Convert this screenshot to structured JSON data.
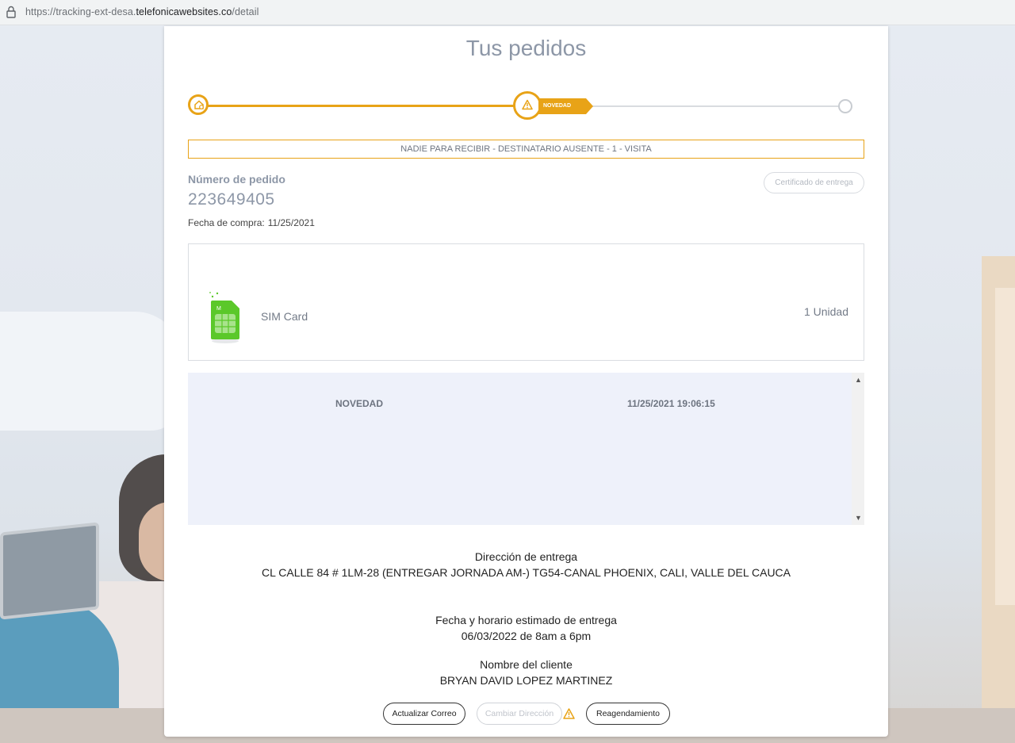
{
  "browser": {
    "url_prefix": "https://tracking-ext-desa.",
    "url_domain": "telefonicawebsites.co",
    "url_path": "/detail",
    "lock_icon": "lock-icon"
  },
  "page": {
    "title": "Tus pedidos",
    "tracker": {
      "current_step_label": "NOVEDAD",
      "accent_color": "#e8a317"
    },
    "alert_message": "NADIE PARA RECIBIR - DESTINATARIO AUSENTE - 1 - VISITA",
    "order": {
      "label": "Número de pedido",
      "number": "223649405",
      "purchase_date_label": "Fecha de compra:",
      "purchase_date": "11/25/2021",
      "certificate_button": "Certificado de entrega"
    },
    "product": {
      "icon": "sim-card-icon",
      "name": "SIM Card",
      "quantity": "1 Unidad"
    },
    "history": [
      {
        "status": "NOVEDAD",
        "datetime": "11/25/2021 19:06:15"
      }
    ],
    "delivery": {
      "address_label": "Dirección de entrega",
      "address": "CL CALLE 84 # 1LM-28 (ENTREGAR JORNADA AM-) TG54-CANAL PHOENIX, CALI, VALLE DEL CAUCA",
      "schedule_label": "Fecha y horario estimado de entrega",
      "schedule": "06/03/2022 de 8am a 6pm",
      "client_label": "Nombre del cliente",
      "client_name": "BRYAN DAVID LOPEZ MARTINEZ"
    },
    "actions": {
      "update_email": "Actualizar Correo",
      "change_address": "Cambiar Dirección",
      "reschedule": "Reagendamiento"
    }
  }
}
